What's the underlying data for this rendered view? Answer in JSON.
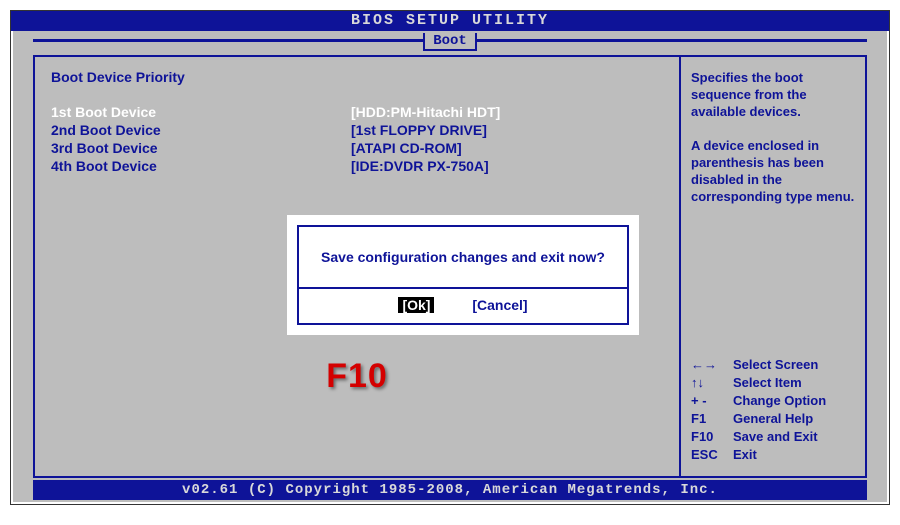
{
  "header": {
    "title": "BIOS SETUP UTILITY"
  },
  "tab": {
    "label": "Boot"
  },
  "main": {
    "section_title": "Boot Device Priority",
    "devices": [
      {
        "label": "1st Boot Device",
        "value": "[HDD:PM-Hitachi HDT]",
        "selected": true
      },
      {
        "label": "2nd Boot Device",
        "value": "[1st FLOPPY DRIVE]",
        "selected": false
      },
      {
        "label": "3rd Boot Device",
        "value": "[ATAPI CD-ROM]",
        "selected": false
      },
      {
        "label": "4th Boot Device",
        "value": "[IDE:DVDR PX-750A]",
        "selected": false
      }
    ]
  },
  "side": {
    "help": "Specifies the boot sequence from the available devices.\n\nA device enclosed in parenthesis has been disabled in the corresponding type menu.",
    "keys": [
      {
        "k": "←→",
        "a": "Select Screen"
      },
      {
        "k": "↑↓",
        "a": "Select Item"
      },
      {
        "k": "+ -",
        "a": "Change Option"
      },
      {
        "k": "F1",
        "a": "General Help"
      },
      {
        "k": "F10",
        "a": "Save and Exit"
      },
      {
        "k": "ESC",
        "a": "Exit"
      }
    ]
  },
  "dialog": {
    "message": "Save configuration changes and exit now?",
    "ok": "[Ok]",
    "cancel": "[Cancel]"
  },
  "annotation": "F10",
  "footer": "v02.61 (C) Copyright 1985-2008, American Megatrends, Inc."
}
